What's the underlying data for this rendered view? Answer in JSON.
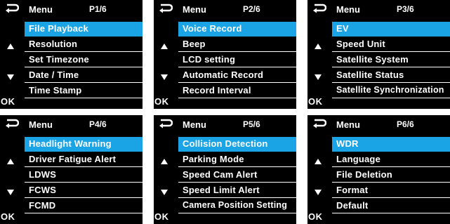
{
  "colors": {
    "background": "#000000",
    "text": "#ffffff",
    "selected": "#1aa4e6",
    "page": "#ffffff"
  },
  "icons": {
    "back": "return-arrow-icon",
    "up": "triangle-up-icon",
    "down": "triangle-down-icon"
  },
  "ok_label": "OK",
  "panels": [
    {
      "title": "Menu",
      "page": "P1/6",
      "items": [
        "File Playback",
        "Resolution",
        "Set Timezone",
        "Date / Time",
        "Time Stamp"
      ],
      "selected_index": 0
    },
    {
      "title": "Menu",
      "page": "P2/6",
      "items": [
        "Voice Record",
        "Beep",
        "LCD setting",
        "Automatic Record",
        "Record Interval"
      ],
      "selected_index": 0
    },
    {
      "title": "Menu",
      "page": "P3/6",
      "items": [
        "EV",
        "Speed Unit",
        "Satellite System",
        "Satellite Status",
        "Satellite Synchronization"
      ],
      "selected_index": 0
    },
    {
      "title": "Menu",
      "page": "P4/6",
      "items": [
        "Headlight Warning",
        "Driver Fatigue Alert",
        "LDWS",
        "FCWS",
        "FCMD"
      ],
      "selected_index": 0
    },
    {
      "title": "Menu",
      "page": "P5/6",
      "items": [
        "Collision Detection",
        "Parking Mode",
        "Speed Cam Alert",
        "Speed Limit Alert",
        "Camera Position Setting"
      ],
      "selected_index": 0
    },
    {
      "title": "Menu",
      "page": "P6/6",
      "items": [
        "WDR",
        "Language",
        "File Deletion",
        "Format",
        "Default"
      ],
      "selected_index": 0
    }
  ]
}
